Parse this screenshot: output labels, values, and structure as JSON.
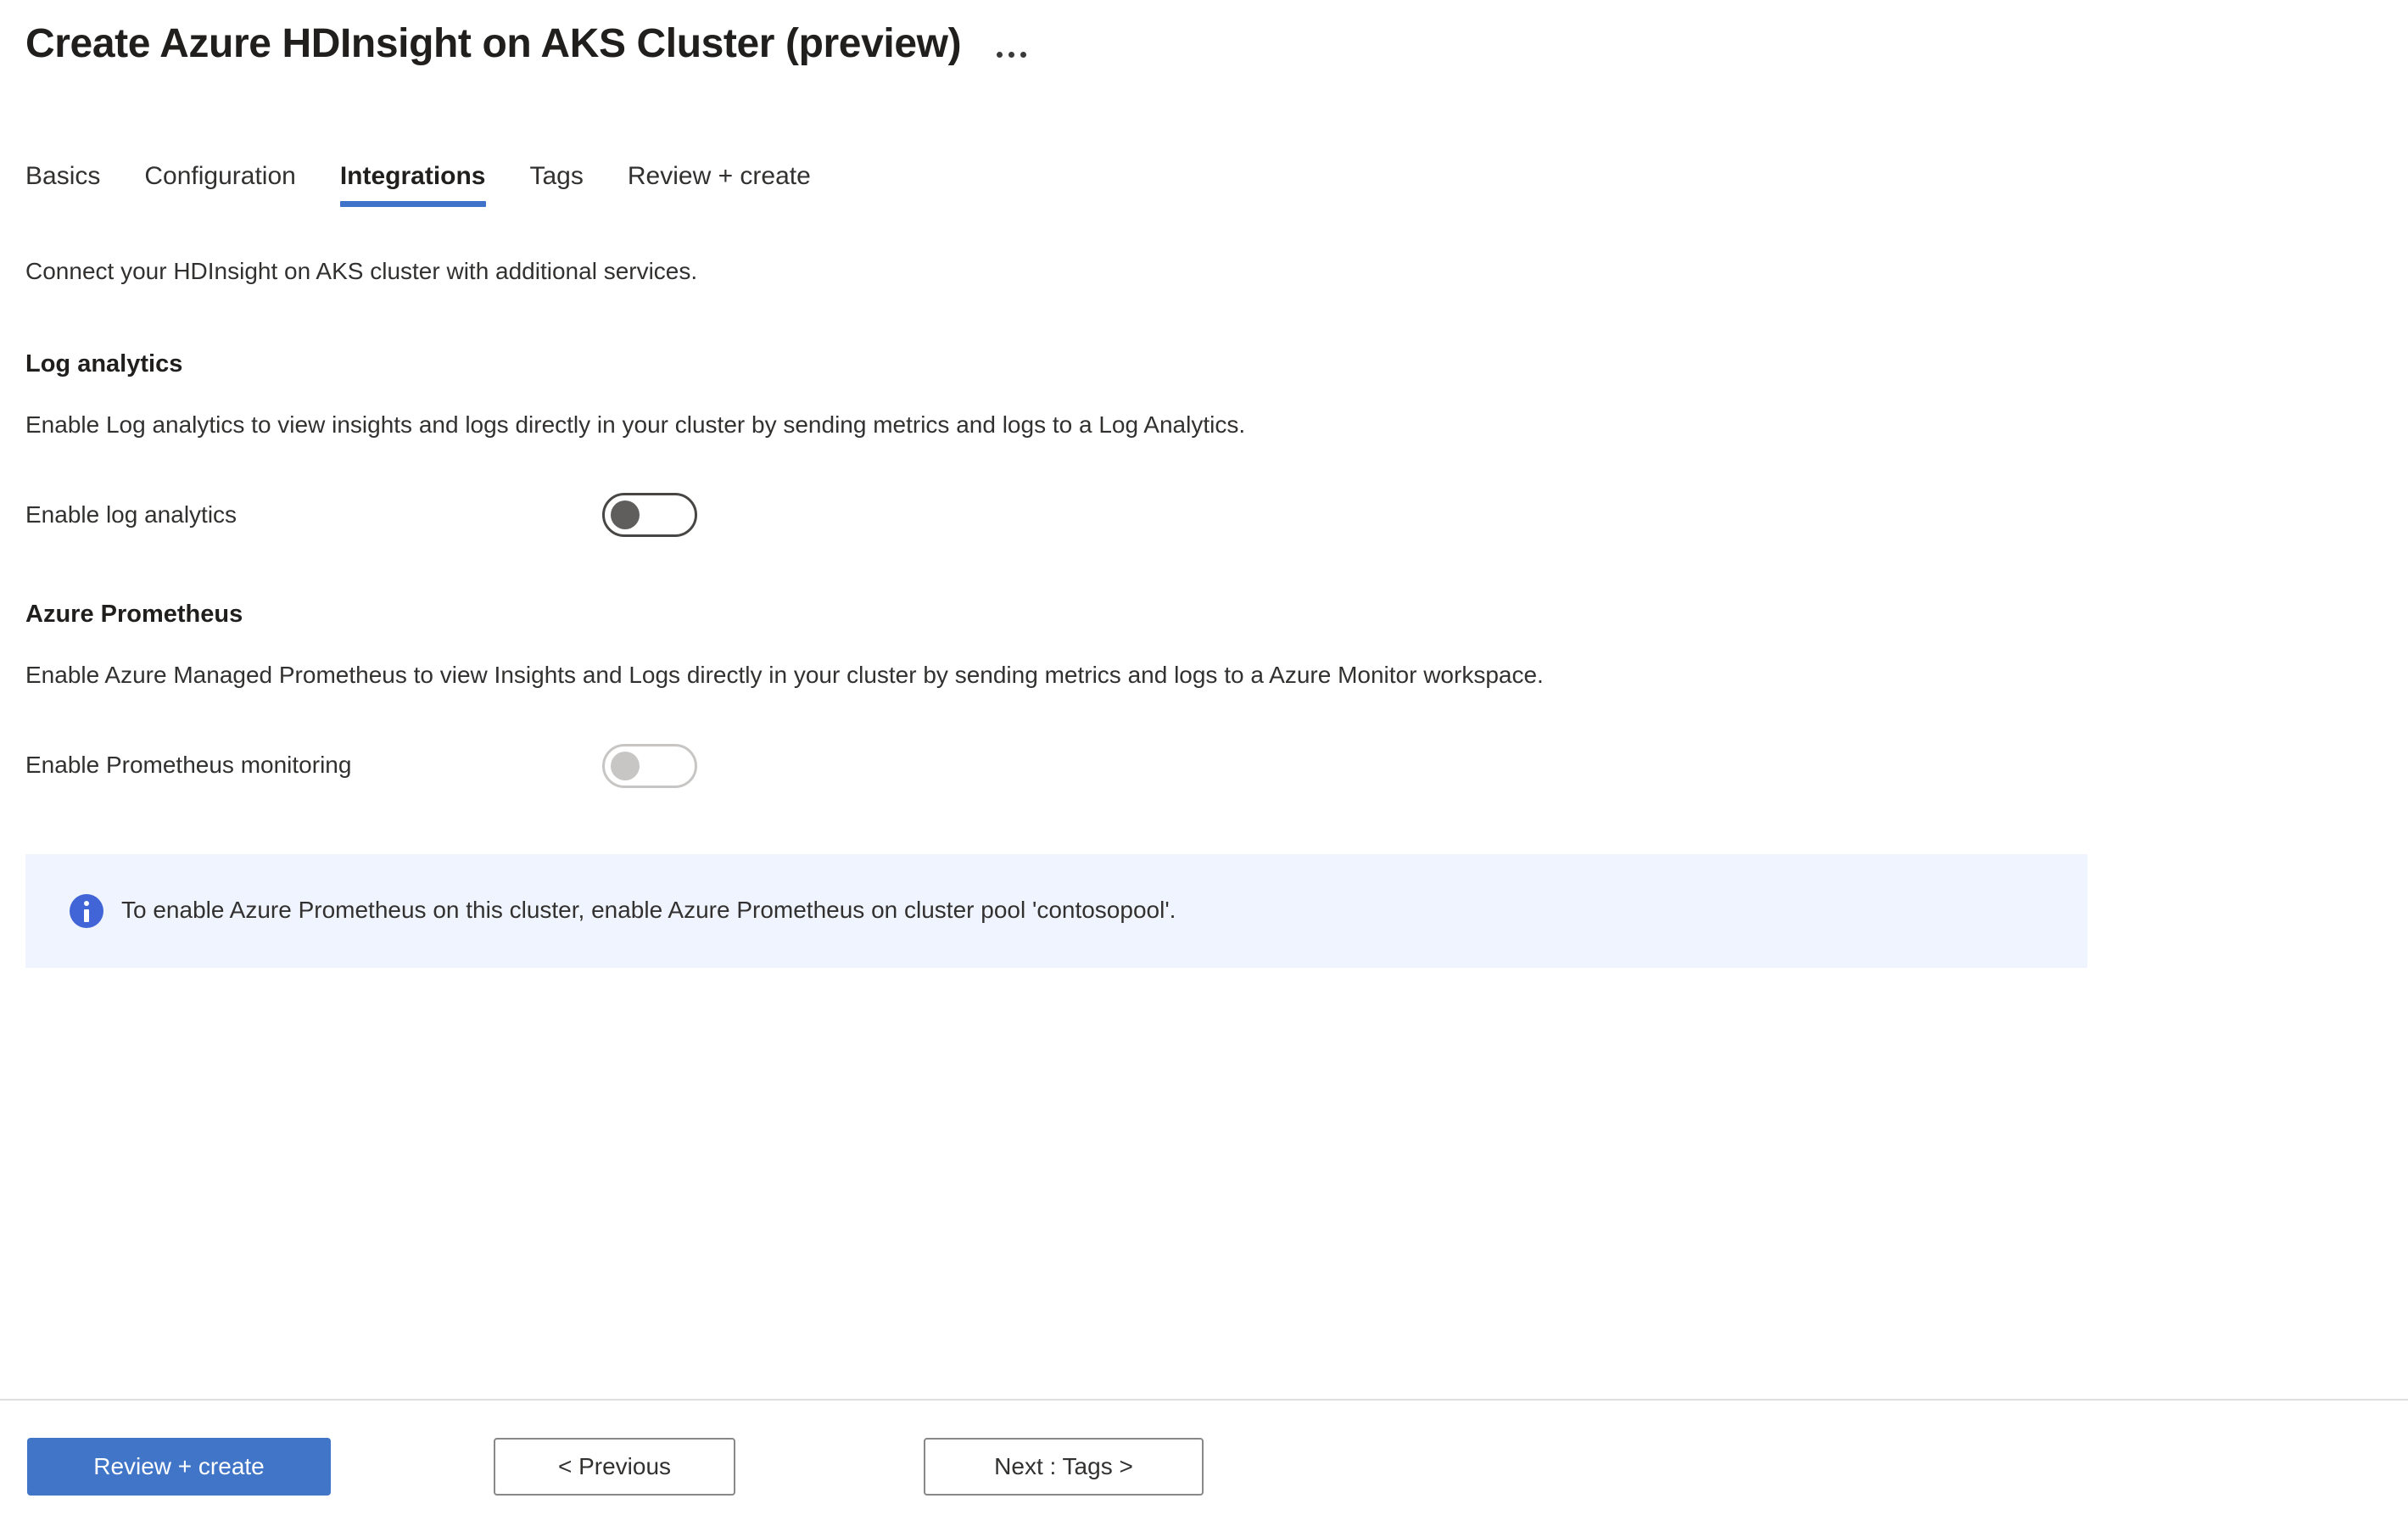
{
  "header": {
    "title": "Create Azure HDInsight on AKS Cluster (preview)",
    "more_menu_label": "..."
  },
  "tabs": [
    {
      "label": "Basics",
      "active": false
    },
    {
      "label": "Configuration",
      "active": false
    },
    {
      "label": "Integrations",
      "active": true
    },
    {
      "label": "Tags",
      "active": false
    },
    {
      "label": "Review + create",
      "active": false
    }
  ],
  "main": {
    "intro": "Connect your HDInsight on AKS cluster with additional services.",
    "sections": [
      {
        "heading": "Log analytics",
        "description": "Enable Log analytics to view insights and logs directly in your cluster by sending metrics and logs to a Log Analytics.",
        "field_label": "Enable log analytics",
        "toggle_state": "off",
        "toggle_disabled": false
      },
      {
        "heading": "Azure Prometheus",
        "description": "Enable Azure Managed Prometheus to view Insights and Logs directly in your cluster by sending metrics and logs to a Azure Monitor workspace.",
        "field_label": "Enable Prometheus monitoring",
        "toggle_state": "off",
        "toggle_disabled": true
      }
    ],
    "info_banner": {
      "icon": "info-icon",
      "message": "To enable Azure Prometheus on this cluster, enable Azure Prometheus on cluster pool 'contosopool'."
    }
  },
  "footer": {
    "review_create_label": "Review + create",
    "previous_label": "< Previous",
    "next_label": "Next : Tags >"
  },
  "colors": {
    "accent_blue": "#4175c8",
    "tab_underline": "#3f72c9",
    "info_banner_bg": "#eff4fe",
    "info_icon_blue": "#4164d6",
    "toggle_border": "#484644",
    "toggle_thumb": "#605e5c",
    "toggle_disabled": "#c8c6c4",
    "text_primary": "#323130",
    "footer_divider": "#e1dfdd"
  }
}
